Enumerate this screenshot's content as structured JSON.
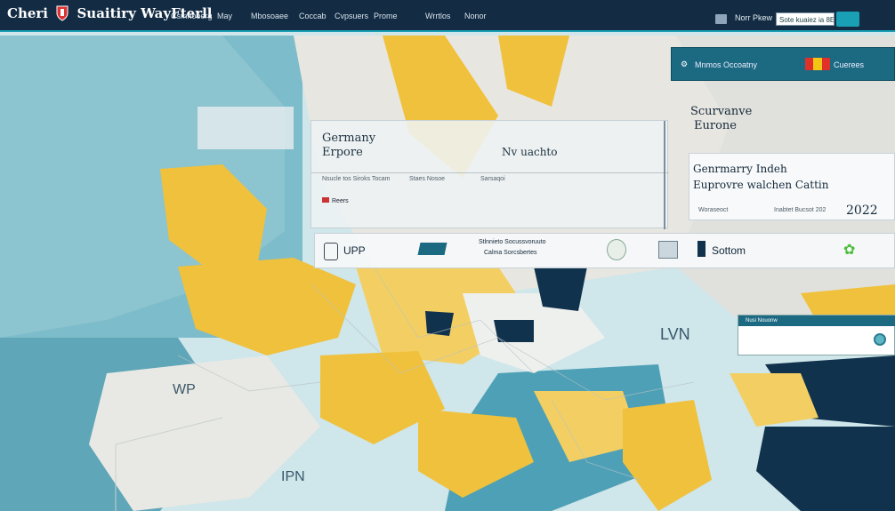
{
  "header": {
    "logo_text_1": "Cheri",
    "logo_text_2": "Suaitiry WayFterll",
    "nav": [
      "Csmnooerg",
      "May",
      "Mbosoaee",
      "Coccab",
      "Cvpsuers",
      "Prome",
      "Wrrtlos",
      "Nonor"
    ],
    "right_label": "Norr Pkew",
    "search_placeholder": "Sote kuaiez ia 8E"
  },
  "top_selector": {
    "label": "Mnmos Occoatny",
    "right": "Cuerees"
  },
  "center_card": {
    "title_1": "Germany",
    "title_2": "Erpore",
    "title_3": "Nv uachto",
    "small_text": [
      "Nsucle tos Siroks Tocam",
      "Staes Nosoe",
      "Sarsaqoi"
    ],
    "tag": "Reers"
  },
  "row_bar": {
    "left": "UPP",
    "middle_line_1": "Stlnnieto Socussvoruuto",
    "middle_line_2": "Calma Sorcsbertes",
    "right": "Sottom"
  },
  "floating_titles": {
    "line1": "Scurvanve",
    "line2": "Eurone"
  },
  "right_card": {
    "line1": "Genrmarry Indeh",
    "line2": "Euprovre walchen Cattin",
    "foot_left": "Woraseoct",
    "foot_mid": "Inabtet Bucsot 202",
    "year": "2022"
  },
  "info_card": {
    "header": "Nusi Nouonw"
  },
  "map_labels": [
    "LVN",
    "WP",
    "IPN"
  ],
  "colors": {
    "navy": "#132c44",
    "teal": "#1c6a82",
    "sea": "#5aa9bb",
    "land_yellow": "#f0c13c",
    "land_light": "#e8e9e4",
    "dark_region": "#11324d"
  }
}
